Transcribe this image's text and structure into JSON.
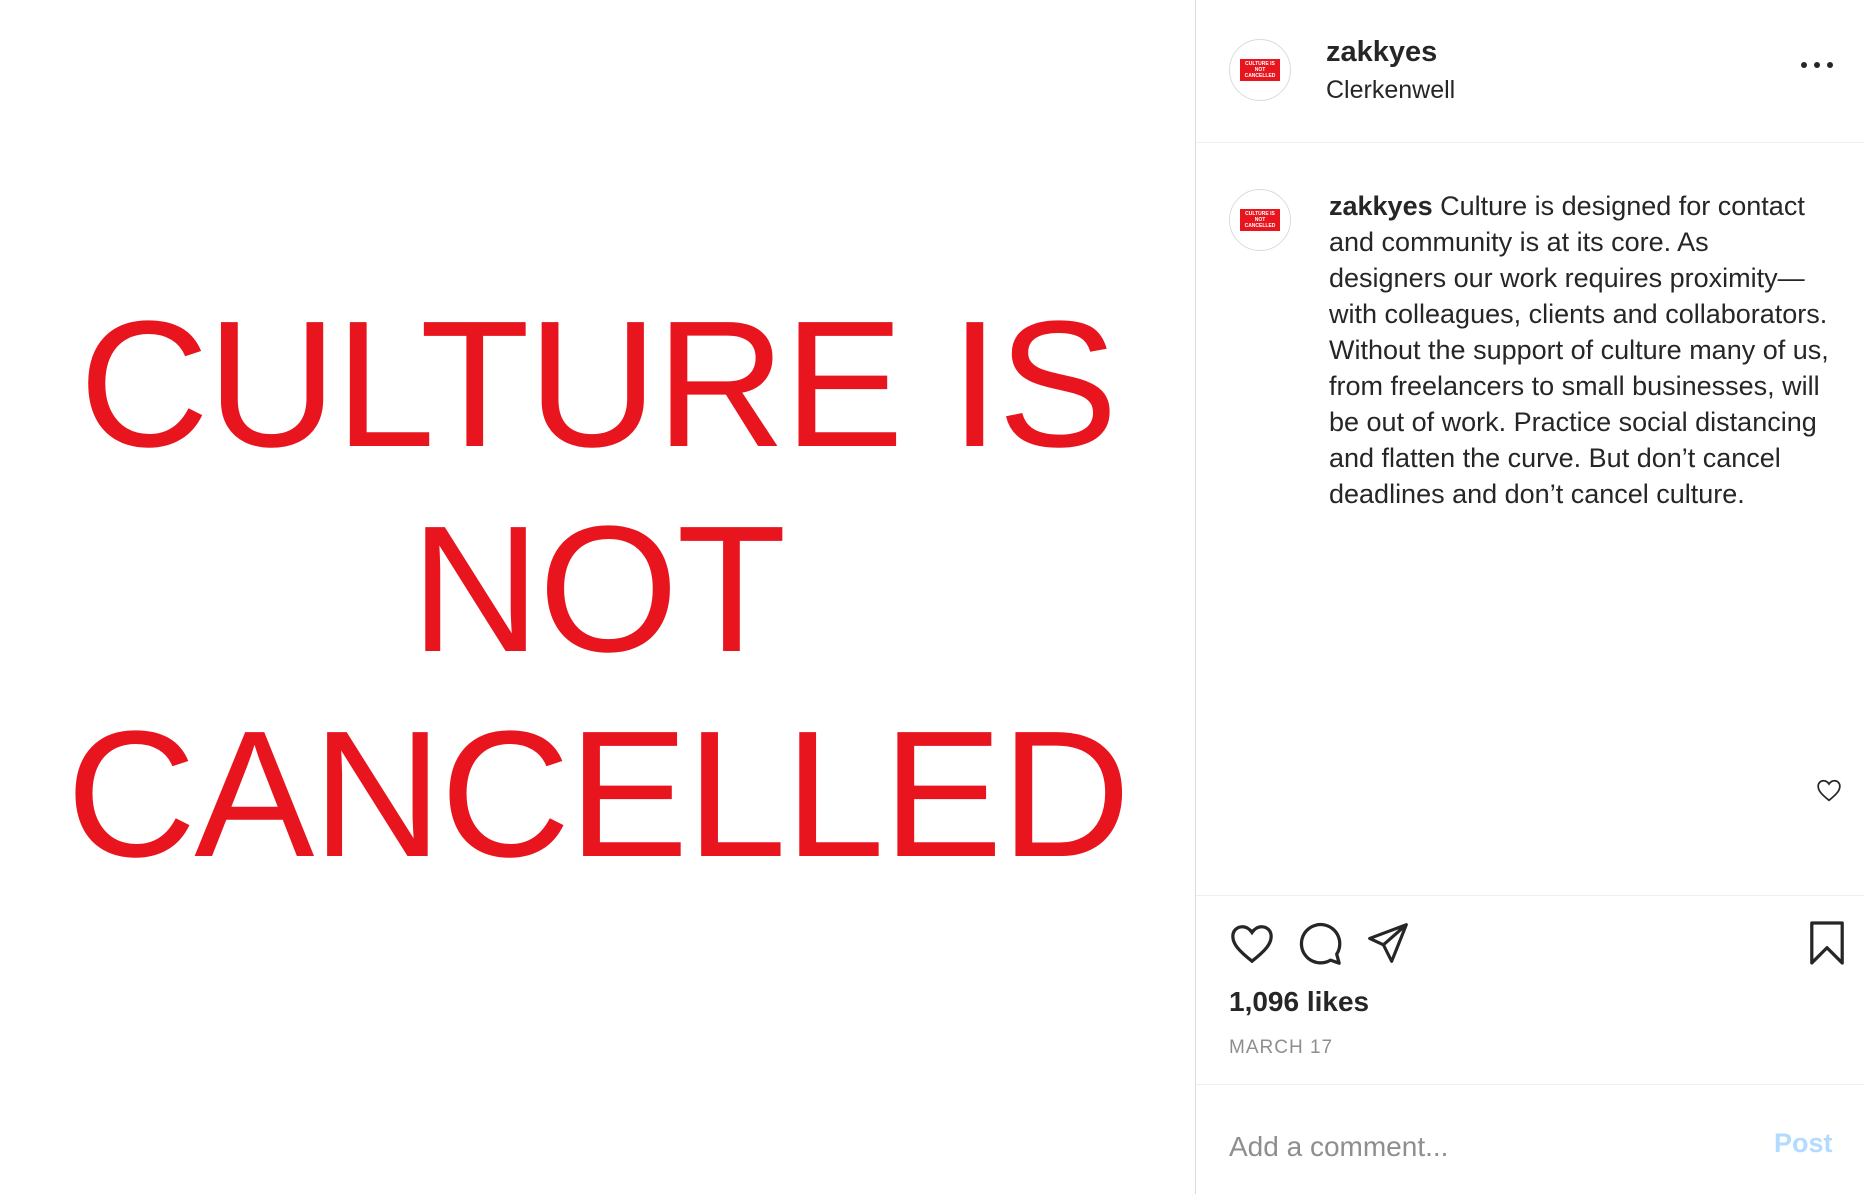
{
  "media": {
    "lines": [
      "CULTURE IS",
      "NOT",
      "CANCELLED"
    ],
    "text_color": "#e8141e"
  },
  "header": {
    "username": "zakkyes",
    "location": "Clerkenwell",
    "avatar_badge_lines": [
      "CULTURE IS",
      "NOT",
      "CANCELLED"
    ]
  },
  "caption": {
    "username": "zakkyes",
    "text": "Culture is designed for contact and community is at its core. As designers our work requires proximity—with colleagues, clients and collaborators. Without the support of culture many of us, from freelancers to small businesses, will be out of work. Practice social distancing and flatten the curve. But don’t cancel deadlines and don’t cancel culture."
  },
  "actions": {
    "icons": [
      "heart-icon",
      "comment-icon",
      "share-icon",
      "bookmark-icon"
    ],
    "likes": "1,096 likes",
    "date": "MARCH 17"
  },
  "comment": {
    "placeholder": "Add a comment...",
    "post_label": "Post",
    "post_color": "#b3dbff"
  }
}
